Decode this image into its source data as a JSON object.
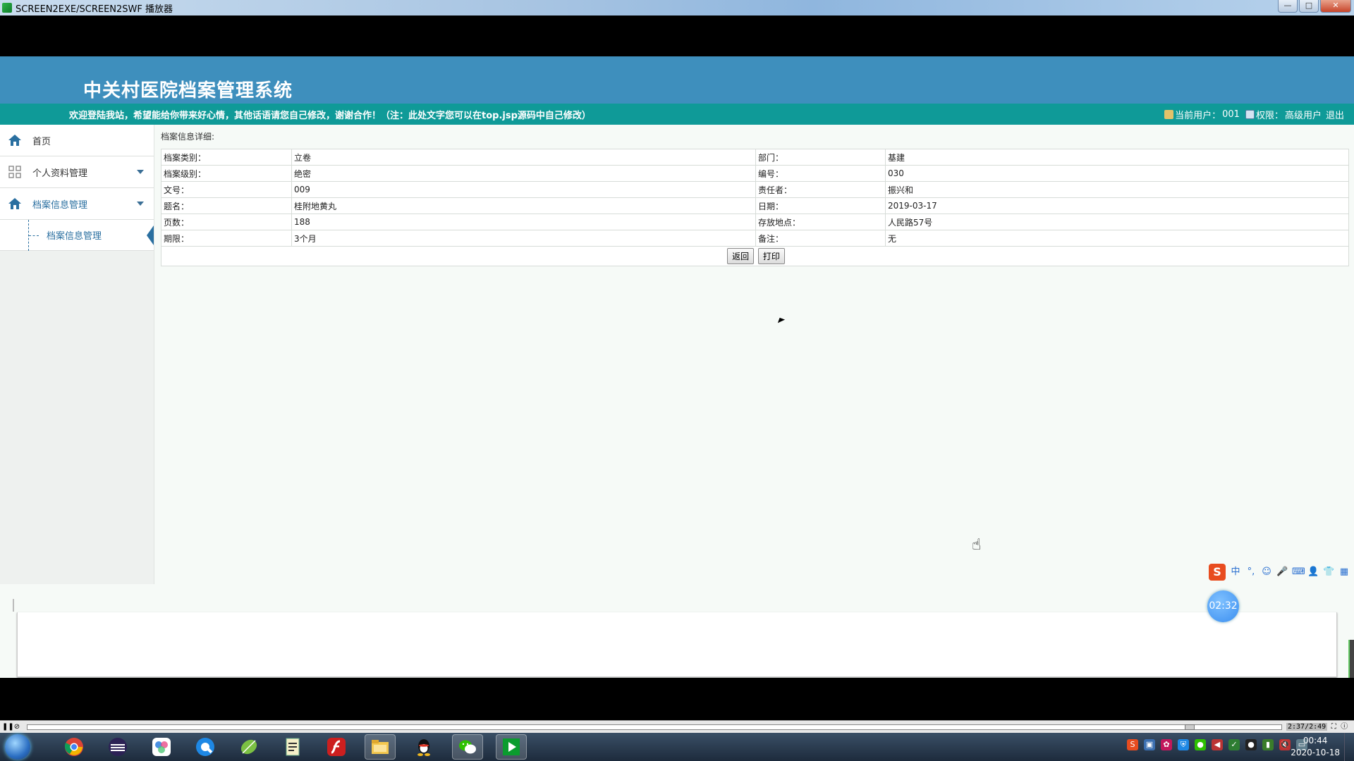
{
  "player": {
    "title": "SCREEN2EXE/SCREEN2SWF 播放器",
    "minimize": "—",
    "maximize": "□",
    "close": "✕",
    "time": "2:37/2:49",
    "progress_fraction": 0.93
  },
  "app": {
    "system_title": "中关村医院档案管理系统",
    "notice": "欢迎登陆我站，希望能给你带来好心情，其他话语请您自己修改，谢谢合作！（注：此处文字您可以在top.jsp源码中自己修改）",
    "current_user_label": "当前用户：",
    "current_user": "001",
    "permission_label": "权限：",
    "permission": "高级用户",
    "logout": "退出"
  },
  "sidebar": {
    "home": "首页",
    "personal": "个人资料管理",
    "archive": "档案信息管理",
    "archive_sub": "档案信息管理"
  },
  "detail": {
    "heading": "档案信息详细:",
    "rows": [
      {
        "l1": "档案类别：",
        "v1": "立卷",
        "l2": "部门：",
        "v2": "基建"
      },
      {
        "l1": "档案级别：",
        "v1": "绝密",
        "l2": "编号：",
        "v2": "030"
      },
      {
        "l1": "文号：",
        "v1": "009",
        "l2": "责任者：",
        "v2": "振兴和"
      },
      {
        "l1": "题名：",
        "v1": "桂附地黄丸",
        "l2": "日期：",
        "v2": "2019-03-17"
      },
      {
        "l1": "页数：",
        "v1": "188",
        "l2": "存放地点：",
        "v2": "人民路57号"
      },
      {
        "l1": "期限：",
        "v1": "3个月",
        "l2": "备注：",
        "v2": "无"
      }
    ],
    "back_button": "返回",
    "print_button": "打印"
  },
  "ime": {
    "logo": "S",
    "mode": "中",
    "punct": "°,"
  },
  "timer": "02:32",
  "taskbar": {
    "time": "00:44",
    "date": "2020-10-18"
  },
  "colors": {
    "banner": "#3e8fbd",
    "notice_bar": "#0f9a98",
    "link": "#2a6fa0"
  }
}
